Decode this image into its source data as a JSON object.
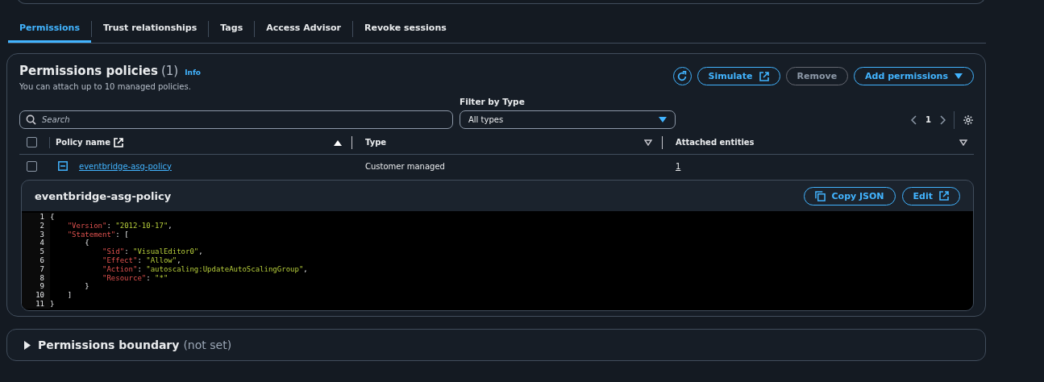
{
  "tabs": [
    {
      "label": "Permissions",
      "selected": true
    },
    {
      "label": "Trust relationships",
      "selected": false
    },
    {
      "label": "Tags",
      "selected": false
    },
    {
      "label": "Access Advisor",
      "selected": false
    },
    {
      "label": "Revoke sessions",
      "selected": false
    }
  ],
  "policies": {
    "title": "Permissions policies",
    "count": "(1)",
    "info": "Info",
    "description": "You can attach up to 10 managed policies.",
    "buttons": [
      {
        "label": "Simulate",
        "kind": "external",
        "disabled": false
      },
      {
        "label": "Remove",
        "kind": "plain",
        "disabled": true
      },
      {
        "label": "Add permissions",
        "kind": "dropdown",
        "disabled": false
      }
    ],
    "search": {
      "placeholder": "Search"
    },
    "filter": {
      "label": "Filter by Type",
      "value": "All types"
    },
    "page": "1",
    "columns": [
      {
        "label": "Policy name",
        "kind": "external",
        "sorted": true
      },
      {
        "label": "Type",
        "kind": "plain",
        "sorted": false
      },
      {
        "label": "Attached entities",
        "kind": "plain",
        "sorted": false
      }
    ],
    "select_all": {
      "checked": false
    },
    "rows": [
      {
        "checked": false,
        "expanded": true,
        "name": "eventbridge-asg-policy",
        "type": "Customer managed",
        "attached": "1"
      }
    ],
    "detail": {
      "title": "eventbridge-asg-policy",
      "buttons": [
        {
          "label": "Copy JSON",
          "kind": "copy"
        },
        {
          "label": "Edit",
          "kind": "external"
        }
      ],
      "code": [
        {
          "num": "1",
          "text": "{"
        },
        {
          "num": "2",
          "text": "    \"Version\": \"2012-10-17\","
        },
        {
          "num": "3",
          "text": "    \"Statement\": ["
        },
        {
          "num": "4",
          "text": "        {"
        },
        {
          "num": "5",
          "text": "            \"Sid\": \"VisualEditor0\","
        },
        {
          "num": "6",
          "text": "            \"Effect\": \"Allow\","
        },
        {
          "num": "7",
          "text": "            \"Action\": \"autoscaling:UpdateAutoScalingGroup\","
        },
        {
          "num": "8",
          "text": "            \"Resource\": \"*\""
        },
        {
          "num": "9",
          "text": "        }"
        },
        {
          "num": "10",
          "text": "    ]"
        },
        {
          "num": "11",
          "text": "}"
        }
      ]
    }
  },
  "boundary": {
    "title": "Permissions boundary",
    "note": "(not set)",
    "expanded": false
  }
}
